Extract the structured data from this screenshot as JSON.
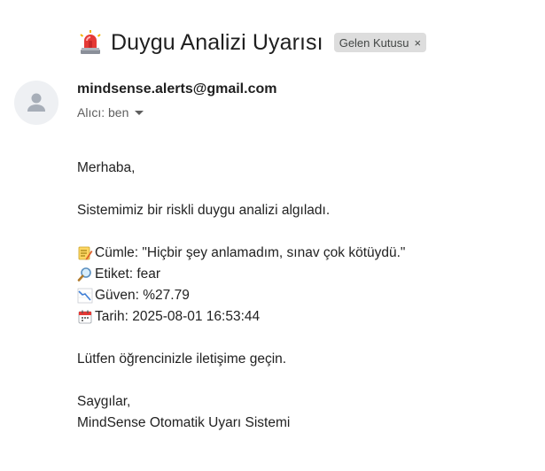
{
  "email": {
    "subject": "Duygu Analizi Uyarısı",
    "label_chip": "Gelen Kutusu",
    "label_chip_close": "×",
    "sender": "mindsense.alerts@gmail.com",
    "recipient": "Alıcı: ben"
  },
  "body": {
    "greeting": "Merhaba,",
    "intro": "Sistemimiz bir riskli duygu analizi algıladı.",
    "sentence_line": "Cümle: \"Hiçbir şey anlamadım, sınav çok kötüydü.\"",
    "label_line": "Etiket: fear",
    "confidence_line": "Güven: %27.79",
    "date_line": "Tarih: 2025-08-01 16:53:44",
    "request": "Lütfen öğrencinizle iletişime geçin.",
    "closing": "Saygılar,",
    "signature": "MindSense Otomatik Uyarı Sistemi"
  },
  "icons": {
    "subject": "siren-icon",
    "sentence": "memo-icon",
    "label": "magnifier-icon",
    "confidence": "chart-decreasing-icon",
    "date": "calendar-icon",
    "avatar": "person-icon",
    "recipient_toggle": "caret-down-icon"
  },
  "colors": {
    "chip_bg": "#dddddd",
    "siren_red": "#e53935",
    "avatar_bg": "#eef0f3"
  }
}
